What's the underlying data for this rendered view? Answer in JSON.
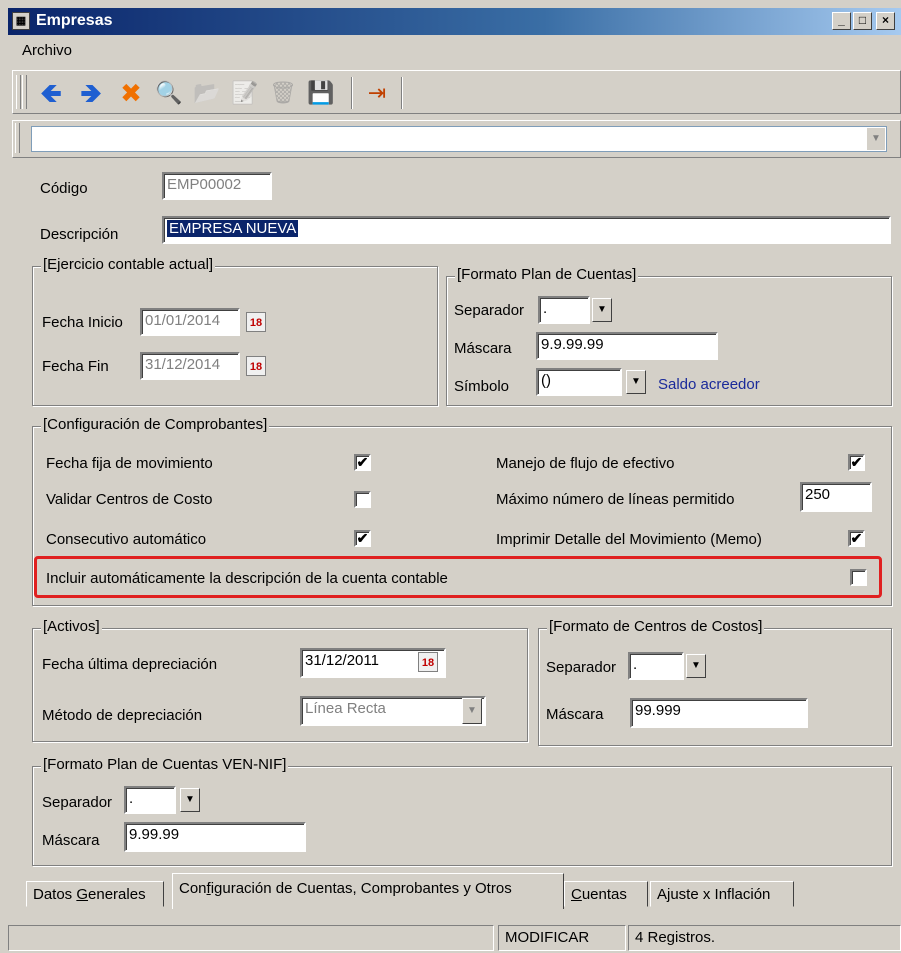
{
  "window": {
    "title": "Empresas",
    "app_icon": "app-icon",
    "min_label": "_",
    "max_label": "□",
    "close_label": "×"
  },
  "menu": {
    "archivo": "Archivo"
  },
  "toolbar": {
    "icons": [
      "arrow-left-icon",
      "arrow-right-icon",
      "delete-icon",
      "search-icon",
      "new-folder-icon",
      "edit-icon",
      "trash-icon",
      "save-icon",
      "exit-icon"
    ],
    "glyphs": {
      "back": "🡸",
      "forward": "🡺",
      "delete": "✖",
      "search": "🔍",
      "open": "📂",
      "edit": "📝",
      "trash": "🗑",
      "save": "💾",
      "exit": "⇥"
    },
    "colors": {
      "arrow": "#1f5fd1",
      "delete": "#f07000"
    }
  },
  "record_combo": {
    "value": ""
  },
  "general": {
    "codigo_label": "Código",
    "codigo_value": "EMP00002",
    "descripcion_label": "Descripción",
    "descripcion_value": "EMPRESA NUEVA"
  },
  "ejercicio": {
    "title": "[Ejercicio contable actual]",
    "fecha_inicio_label": "Fecha Inicio",
    "fecha_inicio_value": "01/01/2014",
    "fecha_fin_label": "Fecha Fin",
    "fecha_fin_value": "31/12/2014"
  },
  "plan_cuentas": {
    "title": "[Formato Plan de Cuentas]",
    "separador_label": "Separador",
    "separador_value": ".",
    "mascara_label": "Máscara",
    "mascara_value": "9.9.99.99",
    "simbolo_label": "Símbolo",
    "simbolo_value": "()",
    "simbolo_note": "Saldo acreedor"
  },
  "comprobantes": {
    "title": "[Configuración de Comprobantes]",
    "fecha_fija_label": "Fecha fija de movimiento",
    "fecha_fija_checked": true,
    "validar_label": "Validar Centros de Costo",
    "validar_checked": false,
    "consecutivo_label": "Consecutivo automático",
    "consecutivo_checked": true,
    "flujo_label": "Manejo de flujo de efectivo",
    "flujo_checked": true,
    "max_lineas_label": "Máximo número de líneas  permitido",
    "max_lineas_value": "250",
    "imprimir_label": "Imprimir Detalle del  Movimiento (Memo)",
    "imprimir_checked": true,
    "incluir_label": "Incluir automáticamente la descripción de la cuenta contable",
    "incluir_checked": false,
    "check_glyph": "✔",
    "highlight_color": "#e02020"
  },
  "activos": {
    "title": "[Activos]",
    "fecha_dep_label": "Fecha última depreciación",
    "fecha_dep_value": "31/12/2011",
    "metodo_label": "Método de depreciación",
    "metodo_value": "Línea Recta"
  },
  "centros": {
    "title": "[Formato de Centros de Costos]",
    "separador_label": "Separador",
    "separador_value": ".",
    "mascara_label": "Máscara",
    "mascara_value": "99.999"
  },
  "ven_nif": {
    "title": "[Formato Plan de Cuentas VEN-NIF]",
    "separador_label": "Separador",
    "separador_value": ".",
    "mascara_label": "Máscara",
    "mascara_value": "9.99.99"
  },
  "tabs": {
    "datos_pre": "Datos ",
    "datos_u": "G",
    "datos_post": "enerales",
    "config_pre": "Con",
    "config_u": "f",
    "config_post": "iguración de Cuentas, Comprobantes y Otros",
    "cuentas_u": "C",
    "cuentas_post": "uentas",
    "ajuste": "Ajuste x Inflación"
  },
  "status": {
    "mode": "MODIFICAR",
    "records": "4 Registros."
  }
}
